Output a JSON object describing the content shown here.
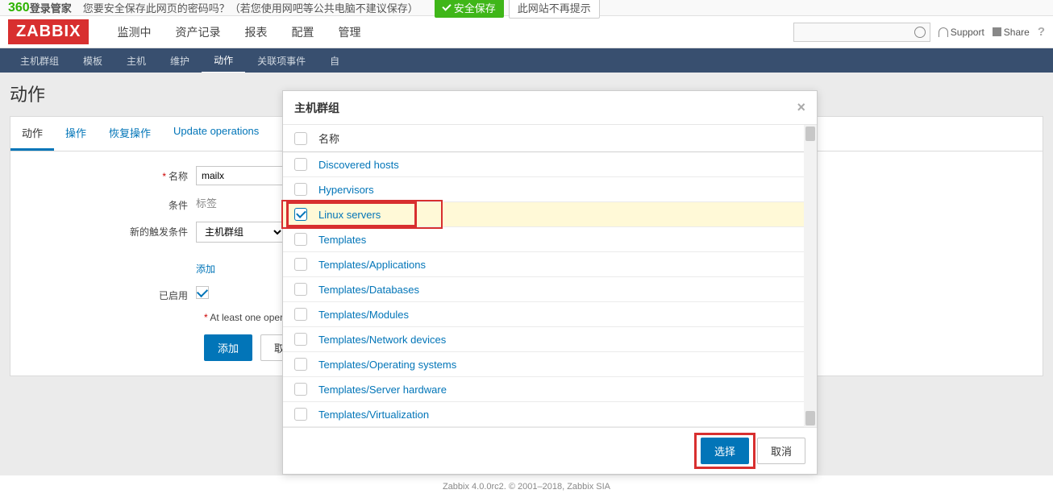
{
  "topbar": {
    "brand_prefix": "360",
    "brand_suffix": "登录管家",
    "prompt": "您要安全保存此网页的密码吗？（若您使用网吧等公共电脑不建议保存）",
    "save_btn": "安全保存",
    "never_btn": "此网站不再提示"
  },
  "header": {
    "logo": "ZABBIX",
    "nav": [
      "监测中",
      "资产记录",
      "报表",
      "配置",
      "管理"
    ],
    "nav_active_index": 3,
    "support": "Support",
    "share": "Share",
    "question": "?"
  },
  "subnav": {
    "items": [
      "主机群组",
      "模板",
      "主机",
      "维护",
      "动作",
      "关联项事件",
      "自"
    ],
    "active_index": 4
  },
  "page": {
    "title": "动作",
    "tabs": [
      "动作",
      "操作",
      "恢复操作",
      "Update operations"
    ],
    "tab_active_index": 0
  },
  "form": {
    "name_label": "名称",
    "name_value": "mailx",
    "condition_label": "条件",
    "condition_header": "标签",
    "trigger_label": "新的触发条件",
    "trigger_select_value": "主机群组",
    "add_link": "添加",
    "enabled_label": "已启用",
    "footnote": "At least one operatio",
    "add_btn": "添加",
    "cancel_btn": "取消"
  },
  "modal": {
    "title": "主机群组",
    "header_col": "名称",
    "items": [
      {
        "label": "Discovered hosts",
        "checked": false
      },
      {
        "label": "Hypervisors",
        "checked": false
      },
      {
        "label": "Linux servers",
        "checked": true,
        "highlight": true
      },
      {
        "label": "Templates",
        "checked": false
      },
      {
        "label": "Templates/Applications",
        "checked": false
      },
      {
        "label": "Templates/Databases",
        "checked": false
      },
      {
        "label": "Templates/Modules",
        "checked": false
      },
      {
        "label": "Templates/Network devices",
        "checked": false
      },
      {
        "label": "Templates/Operating systems",
        "checked": false
      },
      {
        "label": "Templates/Server hardware",
        "checked": false
      },
      {
        "label": "Templates/Virtualization",
        "checked": false
      }
    ],
    "select_btn": "选择",
    "cancel_btn": "取消"
  },
  "footer": "Zabbix 4.0.0rc2. © 2001–2018, Zabbix SIA"
}
